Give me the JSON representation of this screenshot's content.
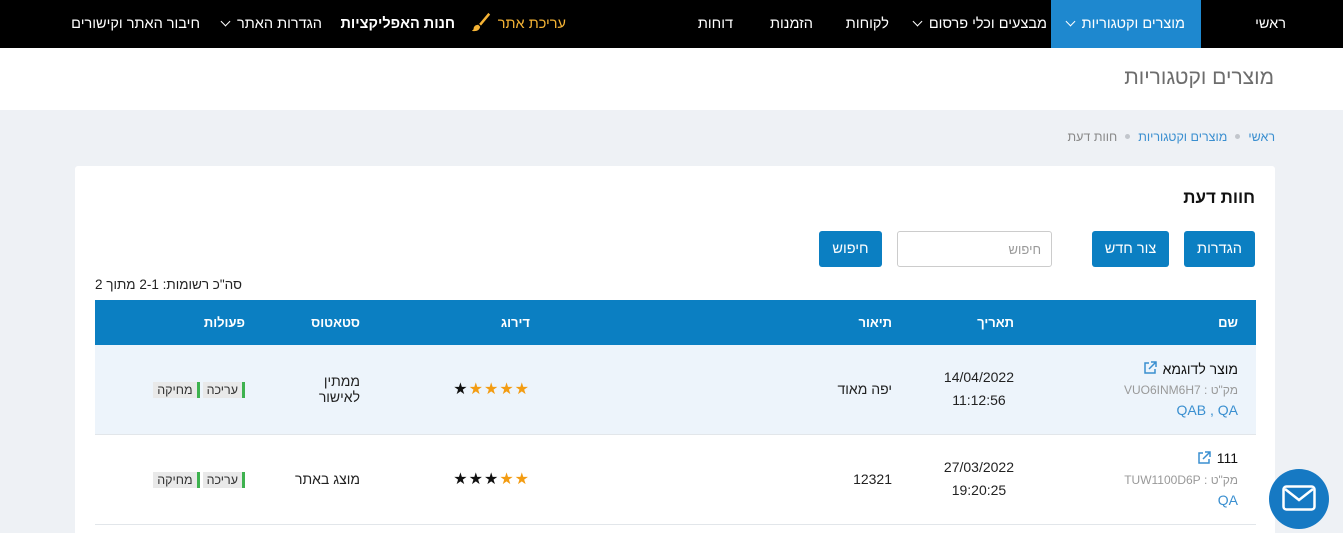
{
  "nav": {
    "home": "ראשי",
    "products": "מוצרים וקטגוריות",
    "promotions": "מבצעים וכלי פרסום",
    "customers": "לקוחות",
    "orders": "הזמנות",
    "reports": "דוחות",
    "edit_site": "עריכת אתר",
    "app_store": "חנות האפליקציות",
    "site_settings": "הגדרות האתר",
    "site_connection": "חיבור האתר וקישורים"
  },
  "page": {
    "title": "מוצרים וקטגוריות"
  },
  "breadcrumb": {
    "home": "ראשי",
    "products": "מוצרים וקטגוריות",
    "current": "חוות דעת"
  },
  "card": {
    "title": "חוות דעת",
    "settings_label": "הגדרות",
    "new_label": "צור חדש",
    "search_placeholder": "חיפוש",
    "search_label": "חיפוש",
    "total_text": "סה\"כ רשומות: 2-1 מתוך 2"
  },
  "table": {
    "headers": {
      "name": "שם",
      "date": "תאריך",
      "description": "תיאור",
      "rating": "דירוג",
      "status": "סטאטוס",
      "actions": "פעולות"
    },
    "edit_label": "עריכה",
    "delete_label": "מחיקה",
    "rows": [
      {
        "name": "מוצר לדוגמא",
        "sku": "מק\"ט : VUO6INM6H7",
        "tags": [
          "QAB",
          "QA"
        ],
        "date": "14/04/2022",
        "time": "11:12:56",
        "description": "יפה מאוד",
        "rating": 4,
        "status": "ממתין לאישור"
      },
      {
        "name": "111",
        "sku": "מק\"ט : TUW1100D6P",
        "tags": [
          "QA"
        ],
        "date": "27/03/2022",
        "time": "19:20:25",
        "description": "12321",
        "rating": 2,
        "status": "מוצג באתר"
      }
    ]
  },
  "colors": {
    "nav_bg": "#000000",
    "accent": "#0b7fc2",
    "active_nav": "#1e88cf",
    "star": "#f39c12",
    "edit_site": "#f5b335"
  }
}
